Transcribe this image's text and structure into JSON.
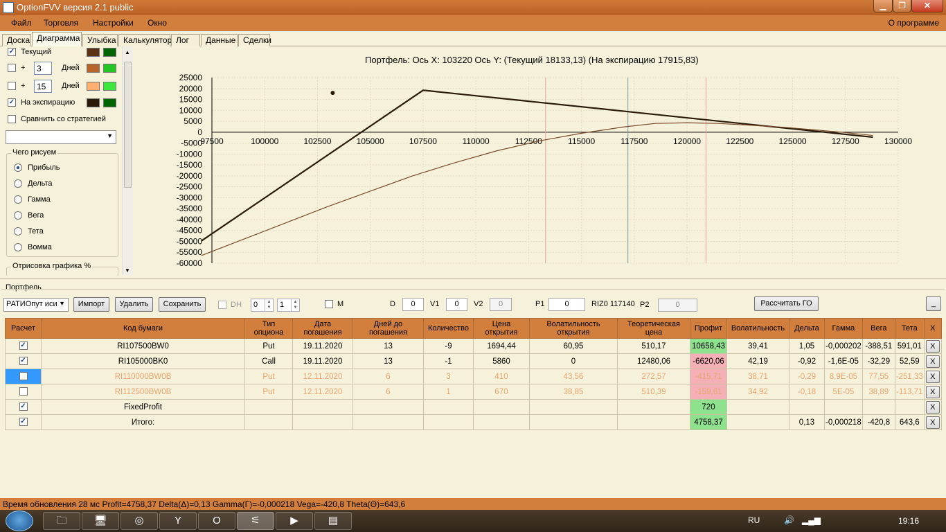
{
  "window": {
    "title": "OptionFVV версия 2.1 public",
    "controls": [
      "▁",
      "❐",
      "✕"
    ]
  },
  "menu": {
    "items": [
      "Файл",
      "Торговля",
      "Настройки",
      "Окно"
    ],
    "about": "О программе"
  },
  "tabs": [
    "Доска",
    "Диаграмма",
    "Улыбка",
    "Калькулятор",
    "Лог",
    "Данные",
    "Сделки"
  ],
  "left_panel": {
    "current_label": "Текущий",
    "plus_label": "+",
    "plus1_value": "3",
    "plus2_value": "15",
    "days_label": "Дней",
    "expiration_label": "На экспирацию",
    "compare_label": "Сравнить со стратегией",
    "compare_select": "",
    "draw_group": "Чего рисуем",
    "radios": [
      "Прибыль",
      "Дельта",
      "Гамма",
      "Вега",
      "Тета",
      "Вомма"
    ],
    "selected_radio": "Прибыль",
    "render_group": "Отрисовка графика %",
    "colors": {
      "current": [
        "#5a3216",
        "#006400"
      ],
      "plus3": [
        "#b8652c",
        "#22c522"
      ],
      "plus15": [
        "#ffb070",
        "#3de63d"
      ],
      "expiration": [
        "#2a1a0a",
        "#006400"
      ]
    }
  },
  "chart_header": "Портфель:  Ось X:  103220  Ось Y:   (Текущий 18133,13)   (На экспирацию  17915,83)",
  "chart_data": {
    "type": "line",
    "xlim": [
      97500,
      130000
    ],
    "ylim": [
      -60000,
      25000
    ],
    "x_ticks": [
      97500,
      100000,
      102500,
      105000,
      107500,
      110000,
      112500,
      115000,
      117500,
      120000,
      122500,
      125000,
      127500,
      130000
    ],
    "y_ticks": [
      25000,
      20000,
      15000,
      10000,
      5000,
      0,
      -5000,
      -10000,
      -15000,
      -20000,
      -25000,
      -30000,
      -35000,
      -40000,
      -45000,
      -50000,
      -55000,
      -60000
    ],
    "grid": true,
    "series": [
      {
        "color": "#2a1a0a",
        "points": [
          [
            97000,
            -49800
          ],
          [
            107500,
            19200
          ],
          [
            128800,
            -2300
          ]
        ]
      },
      {
        "color": "#7a4a28",
        "points": [
          [
            97000,
            -56500
          ],
          [
            99000,
            -49000
          ],
          [
            101000,
            -41500
          ],
          [
            103000,
            -34000
          ],
          [
            105000,
            -27000
          ],
          [
            107000,
            -20000
          ],
          [
            109000,
            -14000
          ],
          [
            111000,
            -8500
          ],
          [
            113000,
            -4000
          ],
          [
            115000,
            -500
          ],
          [
            117000,
            2400
          ],
          [
            118500,
            4000
          ],
          [
            120000,
            4300
          ],
          [
            121500,
            4000
          ],
          [
            123000,
            3200
          ],
          [
            124500,
            2300
          ],
          [
            126000,
            1100
          ],
          [
            127500,
            -200
          ],
          [
            128800,
            -1500
          ]
        ]
      }
    ],
    "marker": [
      103220,
      18000
    ],
    "vlines": [
      {
        "x": 113300,
        "color": "#f5a0a0"
      },
      {
        "x": 117200,
        "color": "#7a9a9a"
      },
      {
        "x": 120900,
        "color": "#f5a0a0"
      }
    ]
  },
  "portfolio": {
    "label": "Портфель",
    "strategy_select": "РАТИОпут иси",
    "import_btn": "Импорт",
    "delete_btn": "Удалить",
    "save_btn": "Сохранить",
    "dh_label": "DH",
    "spin1": "0",
    "spin2": "1",
    "m_label": "M",
    "d_label": "D",
    "d_value": "0",
    "v1_label": "V1",
    "v1_value": "0",
    "v2_label": "V2",
    "v2_value": "0",
    "p1_label": "P1",
    "p1_value": "0",
    "riz_label": "RIZ0 117140",
    "p2_label": "P2",
    "p2_value": "0",
    "calc_btn": "Рассчитать ГО",
    "minimize_btn": "_"
  },
  "table": {
    "headers": [
      "Расчет",
      "Код бумаги",
      "Тип\nопциона",
      "Дата\nпогашения",
      "Дней до\nпогашения",
      "Количество",
      "Цена\nоткрытия",
      "Волатильность\nоткрытия",
      "Теоретическая\nцена",
      "Профит",
      "Волатильность",
      "Дельта",
      "Гамма",
      "Вега",
      "Тета",
      "X"
    ],
    "rows": [
      {
        "checked": true,
        "dim": false,
        "selected": false,
        "profit_state": "pos",
        "cells": [
          "RI107500BW0",
          "Put",
          "19.11.2020",
          "13",
          "-9",
          "1694,44",
          "60,95",
          "510,17",
          "10658,43",
          "39,41",
          "1,05",
          "-0,000202",
          "-388,51",
          "591,01"
        ]
      },
      {
        "checked": true,
        "dim": false,
        "selected": false,
        "profit_state": "neg",
        "cells": [
          "RI105000BK0",
          "Call",
          "19.11.2020",
          "13",
          "-1",
          "5860",
          "0",
          "12480,06",
          "-6620,06",
          "42,19",
          "-0,92",
          "-1,6E-05",
          "-32,29",
          "52,59"
        ]
      },
      {
        "checked": false,
        "dim": true,
        "selected": true,
        "profit_state": "neg",
        "cells": [
          "RI110000BW0B",
          "Put",
          "12.11.2020",
          "6",
          "3",
          "410",
          "43,56",
          "272,57",
          "-415,71",
          "38,71",
          "-0,29",
          "8,9E-05",
          "77,55",
          "-251,33"
        ]
      },
      {
        "checked": false,
        "dim": true,
        "selected": false,
        "profit_state": "neg",
        "cells": [
          "RI112500BW0B",
          "Put",
          "12.11.2020",
          "6",
          "1",
          "670",
          "38,85",
          "510,39",
          "-159,61",
          "34,92",
          "-0,18",
          "5E-05",
          "38,89",
          "-113,71"
        ]
      },
      {
        "checked": true,
        "dim": false,
        "selected": false,
        "profit_state": "pos",
        "cells": [
          "FixedProfit",
          "",
          "",
          "",
          "",
          "",
          "",
          "",
          "720",
          "",
          "",
          "",
          "",
          ""
        ]
      },
      {
        "checked": true,
        "dim": false,
        "selected": false,
        "profit_state": "pos",
        "cells": [
          "Итого:",
          "",
          "",
          "",
          "",
          "",
          "",
          "",
          "4758,37",
          "",
          "0,13",
          "-0,000218",
          "-420,8",
          "643,6"
        ]
      }
    ],
    "remove_label": "X"
  },
  "status": "Время обновления 28 мс  Profit=4758,37 Delta(Δ)=0,13 Gamma(Γ)=-0,000218 Vega=-420,8 Theta(Θ)=643,6",
  "taskbar": {
    "icons": [
      "🗀",
      "🖥",
      "◎",
      "Y",
      "O",
      "⚟",
      "▶",
      "▤"
    ],
    "language": "RU",
    "time": "19:16"
  }
}
